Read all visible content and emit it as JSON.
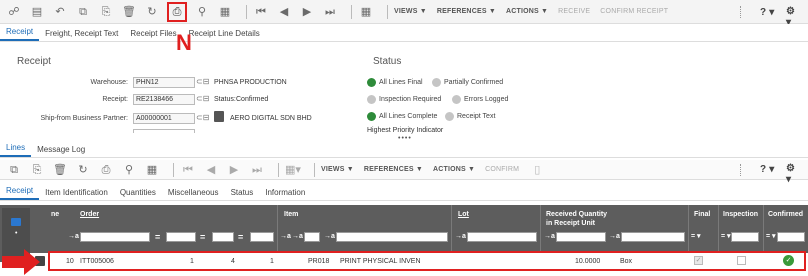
{
  "toolbar1": {
    "views": "VIEWS ▼",
    "references": "REFERENCES ▼",
    "actions": "ACTIONS ▼",
    "receive": "RECEIVE",
    "confirm_receipt": "CONFIRM RECEIPT",
    "help": "? ▾",
    "settings": "⚙ ▾"
  },
  "annotation_letter": "N",
  "tabs1": [
    "Receipt",
    "Freight, Receipt Text",
    "Receipt Files",
    "Receipt Line Details"
  ],
  "receipt": {
    "section_title": "Receipt",
    "warehouse_label": "Warehouse:",
    "warehouse_value": "PHN12",
    "warehouse_desc": "PHNSA PRODUCTION",
    "receipt_label": "Receipt:",
    "receipt_value": "RE2138466",
    "status_label": "Status:",
    "status_value": "Confirmed",
    "shipfrom_label": "Ship-from Business Partner:",
    "shipfrom_value": "A00000001",
    "shipfrom_desc": "AERO DIGITAL SDN BHD"
  },
  "status": {
    "section_title": "Status",
    "items": [
      "All Lines Final",
      "Partially Confirmed",
      "Inspection Required",
      "Errors Logged",
      "All Lines Complete",
      "Receipt Text"
    ],
    "highest_priority": "Highest Priority Indicator"
  },
  "tabs_lower": [
    "Lines",
    "Message Log"
  ],
  "toolbar2": {
    "views": "VIEWS ▼",
    "references": "REFERENCES ▼",
    "actions": "ACTIONS ▼",
    "confirm": "CONFIRM",
    "help": "? ▾",
    "settings": "⚙ ▾"
  },
  "tabs2": [
    "Receipt",
    "Item Identification",
    "Quantities",
    "Miscellaneous",
    "Status",
    "Information"
  ],
  "columns": {
    "line": "ne",
    "order": "Order",
    "item": "Item",
    "lot": "Lot",
    "received_qty": "Received Quantity",
    "received_qty2": "in Receipt Unit",
    "final": "Final",
    "inspection": "Inspection",
    "confirmed": "Confirmed"
  },
  "filter_ops": [
    "→a",
    "=",
    "=",
    "=",
    "→a",
    "→a",
    "→a",
    "→a",
    "→a",
    "= ▾",
    "= ▾",
    "= ▾"
  ],
  "row": {
    "line": "10",
    "order": "ITT005006",
    "pos": "1",
    "seq": "4",
    "set": "1",
    "item": "PR018",
    "item_desc": "PRINT PHYSICAL INVEN",
    "qty": "10.0000",
    "unit": "Box"
  }
}
